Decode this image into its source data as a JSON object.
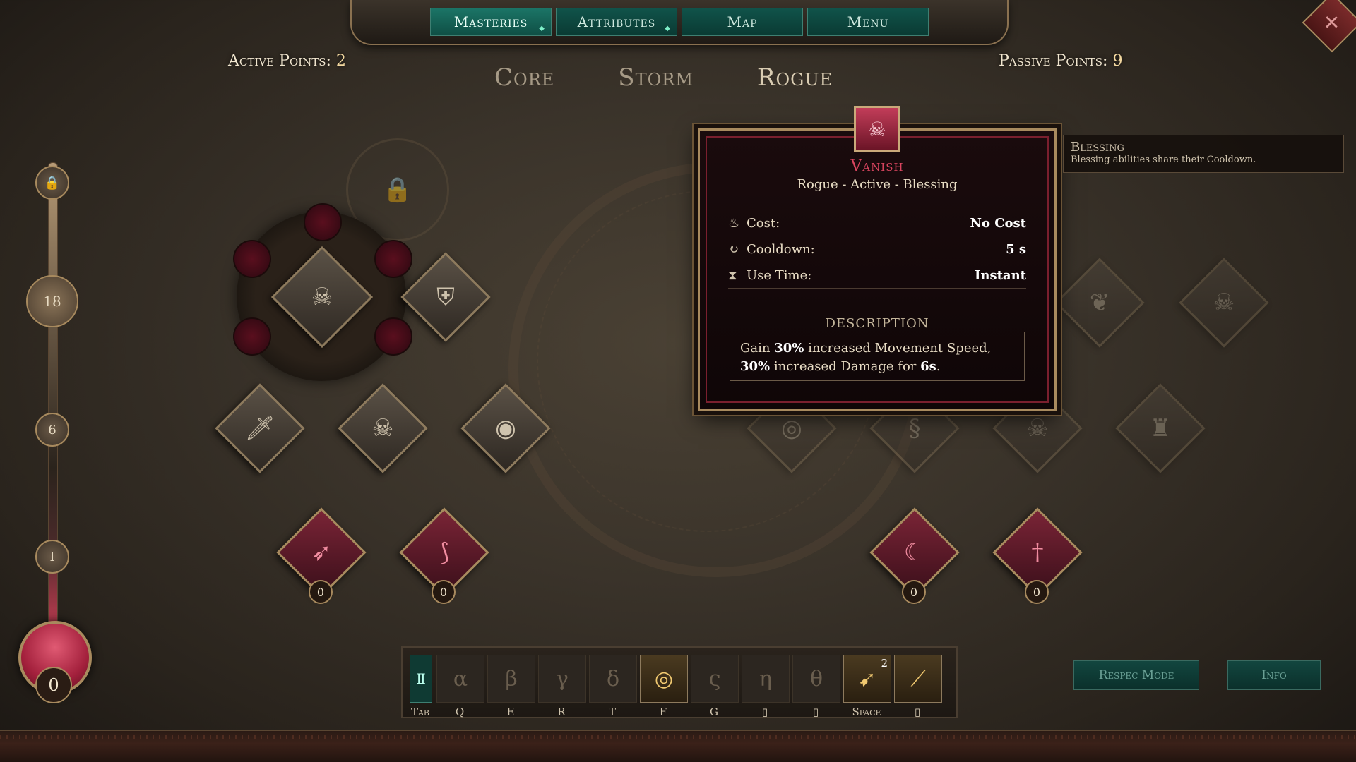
{
  "nav": {
    "tabs": [
      {
        "label": "Masteries"
      },
      {
        "label": "Attributes"
      },
      {
        "label": "Map"
      },
      {
        "label": "Menu"
      }
    ]
  },
  "points": {
    "active_label": "Active Points:",
    "active_value": "2",
    "passive_label": "Passive Points:",
    "passive_value": "9"
  },
  "trees": [
    "Core",
    "Storm",
    "Rogue"
  ],
  "progress": {
    "levels": [
      "18",
      "6",
      "I"
    ],
    "orb_value": "0"
  },
  "skills": {
    "counts": [
      "0",
      "0",
      "0",
      "0"
    ]
  },
  "tooltip": {
    "title": "Vanish",
    "subtitle": "Rogue - Active - Blessing",
    "stats": [
      {
        "label": "Cost:",
        "value": "No Cost",
        "icon": "flame-icon"
      },
      {
        "label": "Cooldown:",
        "value": "5 s",
        "icon": "cooldown-icon"
      },
      {
        "label": "Use Time:",
        "value": "Instant",
        "icon": "hourglass-icon"
      }
    ],
    "description_heading": "DESCRIPTION",
    "description": {
      "p1": "Gain ",
      "v1": "30%",
      "p2": " increased Movement Speed, ",
      "v2": "30%",
      "p3": " increased Damage for ",
      "v3": "6s",
      "p4": "."
    }
  },
  "side_tip": {
    "heading": "Blessing",
    "text": "Blessing abilities share their Cooldown."
  },
  "hotbar": {
    "keys": [
      "Tab",
      "Q",
      "E",
      "R",
      "T",
      "F",
      "G",
      "",
      "",
      "Space",
      ""
    ],
    "slot_glyphs": [
      "α",
      "β",
      "γ",
      "δ",
      "",
      "ς",
      "η",
      "θ"
    ],
    "space_badge": "2"
  },
  "buttons": {
    "respec": "Respec Mode",
    "info": "Info"
  },
  "colors": {
    "accent_teal": "#10534a",
    "accent_red": "#d9455f",
    "gold": "#a88a5e"
  }
}
